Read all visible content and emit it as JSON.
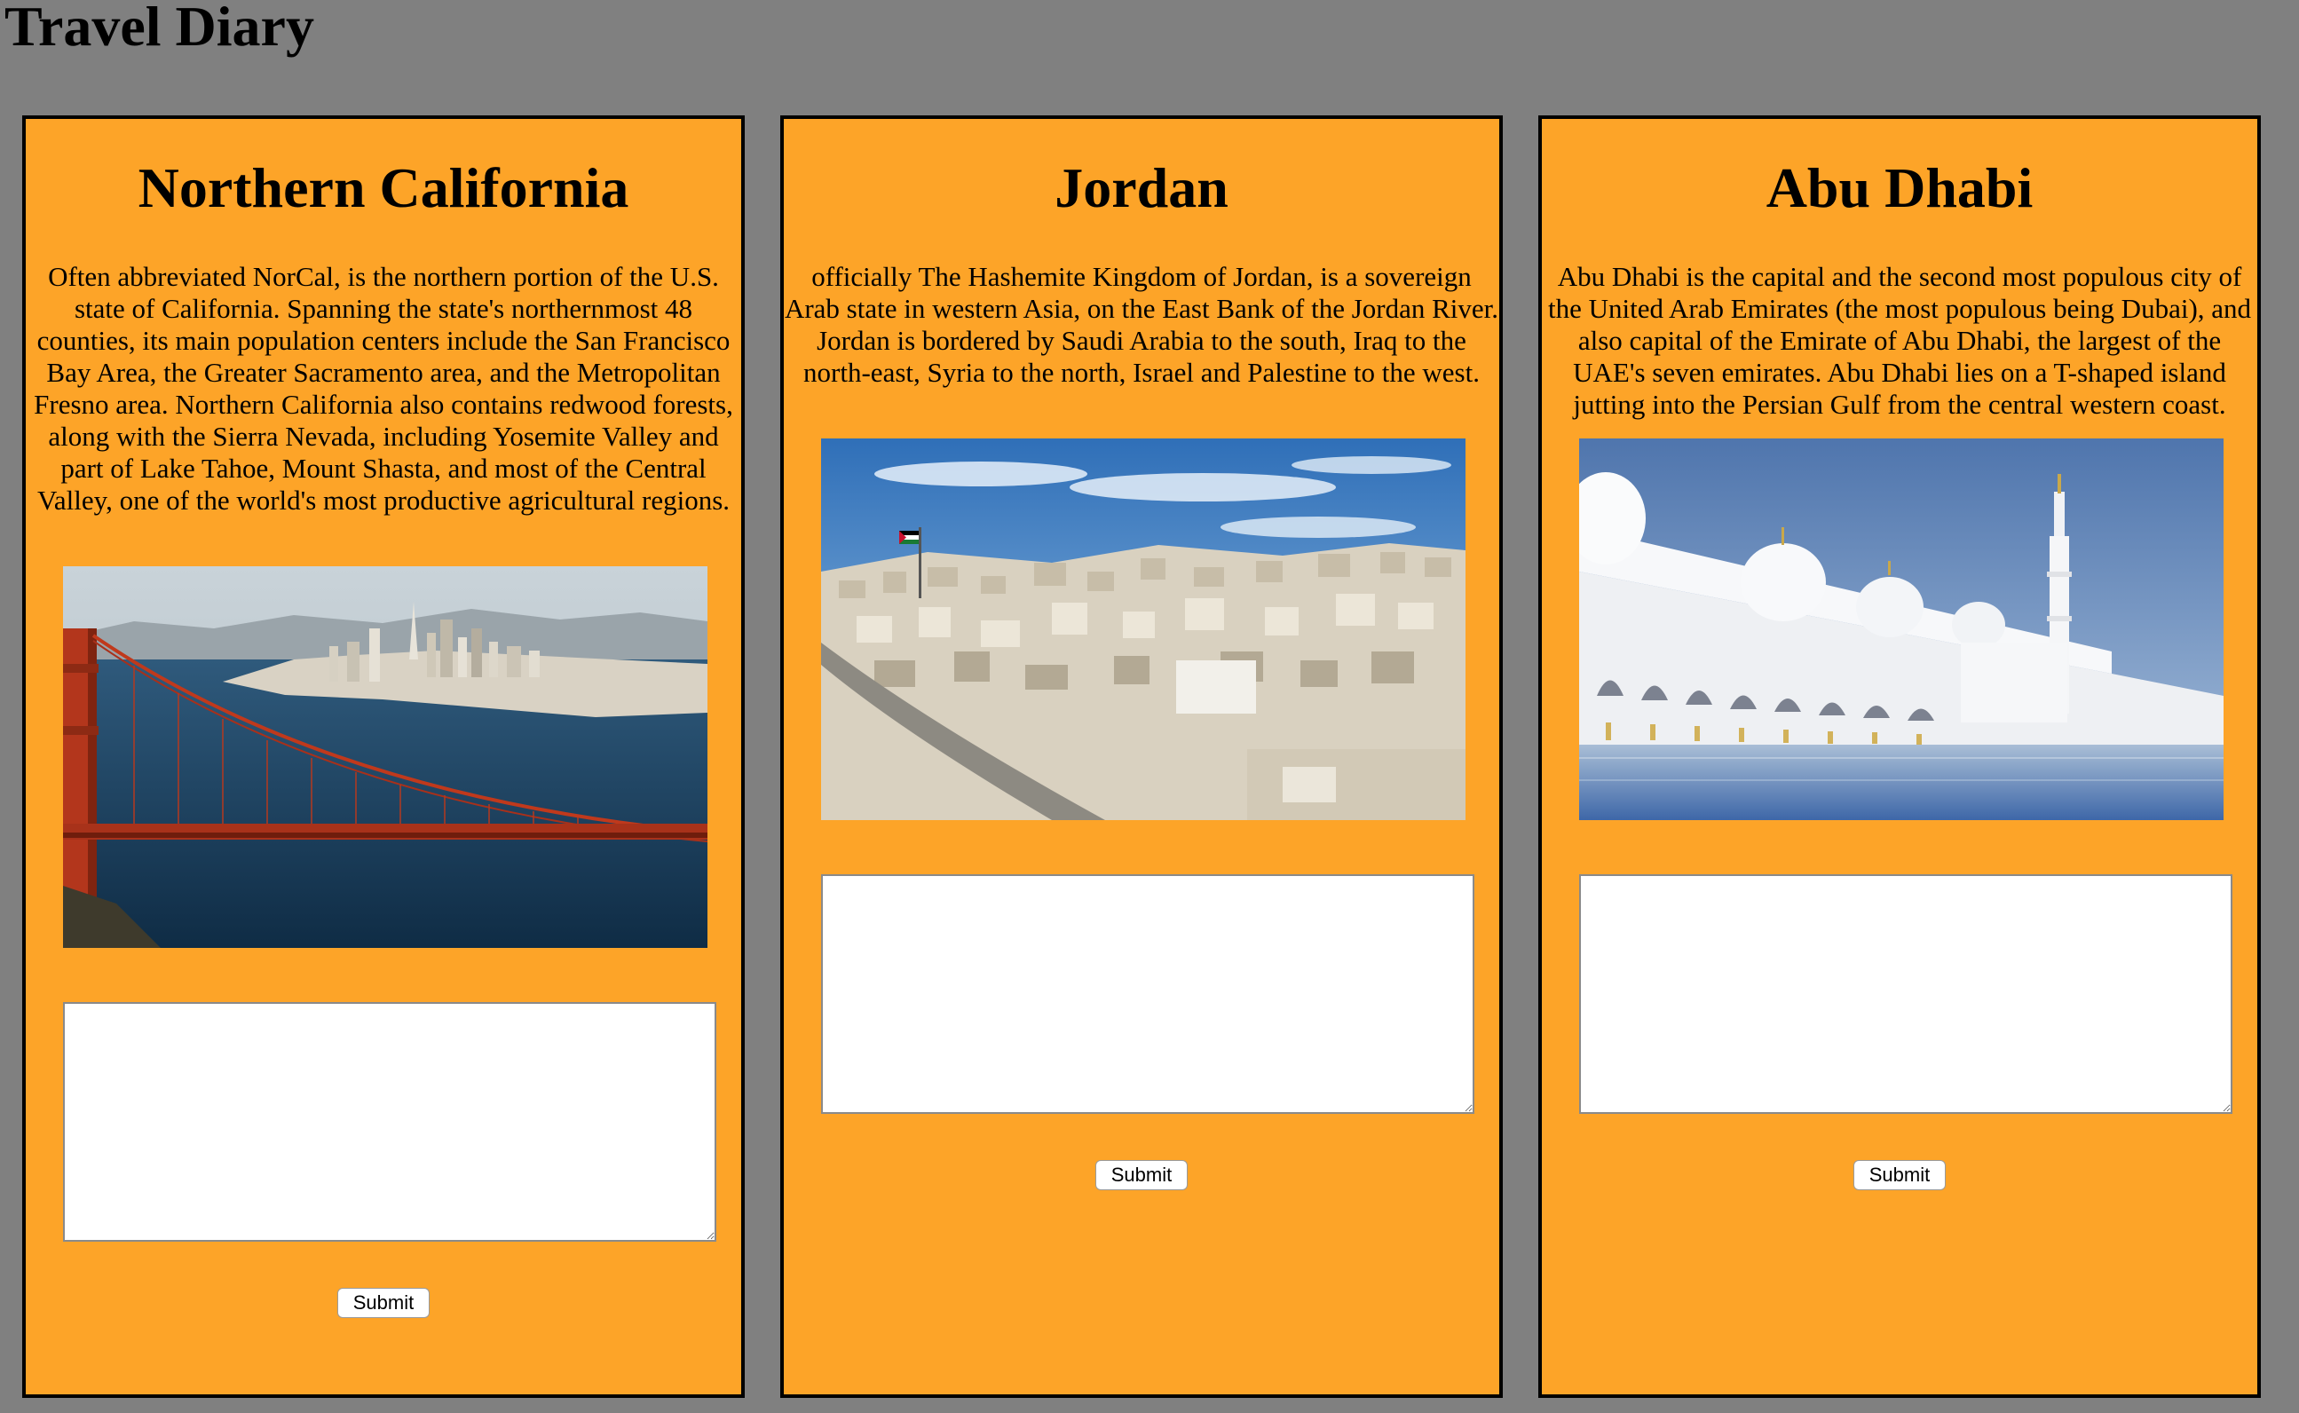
{
  "page": {
    "title": "Travel Diary"
  },
  "cards": [
    {
      "heading": "Northern California",
      "description": "Often abbreviated NorCal, is the northern portion of the U.S. state of California. Spanning the state's northernmost 48 counties, its main population centers include the San Francisco Bay Area, the Greater Sacramento area, and the Metropolitan Fresno area. Northern California also contains redwood forests, along with the Sierra Nevada, including Yosemite Valley and part of Lake Tahoe, Mount Shasta, and most of the Central Valley, one of the world's most productive agricultural regions.",
      "photo_subject": "golden-gate-bridge-san-francisco",
      "entry_value": "",
      "submit_label": "Submit"
    },
    {
      "heading": "Jordan",
      "description": "officially The Hashemite Kingdom of Jordan, is a sovereign Arab state in western Asia, on the East Bank of the Jordan River. Jordan is bordered by Saudi Arabia to the south, Iraq to the north-east, Syria to the north, Israel and Palestine to the west.",
      "photo_subject": "amman-cityscape-with-flag",
      "entry_value": "",
      "submit_label": "Submit"
    },
    {
      "heading": "Abu Dhabi",
      "description": "Abu Dhabi is the capital and the second most populous city of the United Arab Emirates (the most populous being Dubai), and also capital of the Emirate of Abu Dhabi, the largest of the UAE's seven emirates. Abu Dhabi lies on a T-shaped island jutting into the Persian Gulf from the central western coast.",
      "photo_subject": "sheikh-zayed-grand-mosque",
      "entry_value": "",
      "submit_label": "Submit"
    }
  ],
  "colors": {
    "background": "#808080",
    "card": "#fda428",
    "card_border": "#000000"
  }
}
